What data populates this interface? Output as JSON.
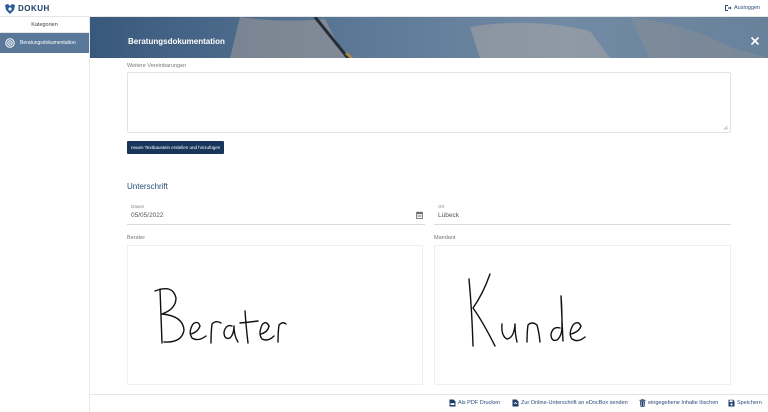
{
  "header": {
    "logo_text": "DOKUH",
    "logout_label": "Ausloggen"
  },
  "sidebar": {
    "heading": "Kategorien",
    "items": [
      {
        "label": "Beratungsdokumentation",
        "active": true
      }
    ]
  },
  "banner": {
    "title": "Beratungsdokumentation"
  },
  "agreements": {
    "label": "Weitere Vereinbarungen",
    "value": ""
  },
  "buttons": {
    "create_text_block": "neuen Textbaustein erstellen und hinzufügen"
  },
  "signature": {
    "section_title": "Unterschrift",
    "date_label": "Datum",
    "date_value": "05/05/2022",
    "place_label": "Ort",
    "place_value": "Lübeck",
    "advisor_label": "Berater",
    "client_label": "Mandant",
    "advisor_signature": "Berater",
    "client_signature": "Kunde"
  },
  "bottom_actions": {
    "print_pdf": "Als PDF Drucken",
    "online_signature": "Zur Online-Unterschrift an eDocBox senden",
    "delete_inputs": "eingegebene Inhalte löschen",
    "save": "Speichern"
  },
  "colors": {
    "primary": "#18365b",
    "accent_text": "#2a4d7a",
    "sidebar_active": "#5a789a"
  }
}
